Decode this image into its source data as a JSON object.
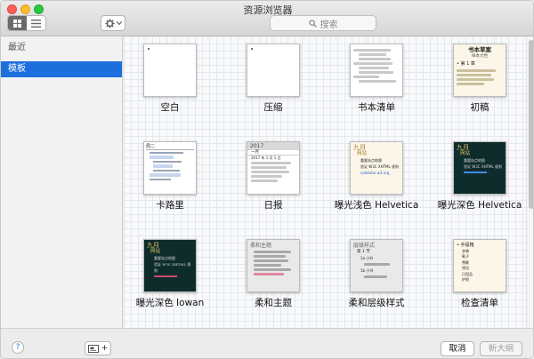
{
  "window": {
    "title": "资源浏览器"
  },
  "toolbar": {
    "view_grid_icon": "grid-icon",
    "view_list_icon": "list-icon",
    "settings_icon": "gear-icon",
    "search_placeholder": "搜索"
  },
  "sidebar": {
    "items": [
      {
        "label": "最近",
        "selected": false
      },
      {
        "label": "模板",
        "selected": true
      }
    ]
  },
  "templates": [
    {
      "caption": "空白"
    },
    {
      "caption": "压缩"
    },
    {
      "caption": "书本清单"
    },
    {
      "caption": "初稿"
    },
    {
      "caption": "卡路里"
    },
    {
      "caption": "日报"
    },
    {
      "caption": "曝光浅色 Helvetica"
    },
    {
      "caption": "曝光深色 Helvetica"
    },
    {
      "caption": "曝光深色 Iowan"
    },
    {
      "caption": "柔和主题"
    },
    {
      "caption": "柔和层级样式"
    },
    {
      "caption": "检查清单"
    }
  ],
  "previews": {
    "draft_title": "书本草案",
    "draft_sub": "样本文档",
    "draft_ch": "• 第 1 章",
    "calorie_day": "周二",
    "daily_year": "2017",
    "daily_month": "一月",
    "daily_date": "2017 年 1 月 1 日",
    "light_month": "九月",
    "light_site": "网站",
    "light_item": "重要站点地图",
    "light_item2": "验证 W3C XHTML 规则",
    "light_link": "validator.w3.org",
    "dark_month": "九月",
    "dark_site": "网站",
    "dark_item": "重要站点地图",
    "dark_item2": "验证 W3C XHTML 规则",
    "iowan_month": "九月",
    "iowan_site": "网站",
    "iowan_item": "重要站点地图",
    "iowan_item2": "验证 W3C XHTML 规则",
    "soft_title": "柔和主题",
    "hier_title": "层级样式",
    "hier_sec": "第 1 节",
    "hier_sub": "1a 小节",
    "hier_sub2": "1b 小节",
    "check_title": "• 手提箱",
    "check_i1": "衣物",
    "check_i2": "鞋子",
    "check_i3": "雪靴",
    "check_i4": "钱包",
    "check_i5": "日用品",
    "check_i6": "护照"
  },
  "footer": {
    "help_label": "?",
    "add_label": "+",
    "cancel_label": "取消",
    "new_label": "新大纲"
  },
  "colors": {
    "selection": "#1e6fde",
    "dark_theme_bg": "#0f2c2c",
    "link_blue": "#2b5fcf"
  }
}
